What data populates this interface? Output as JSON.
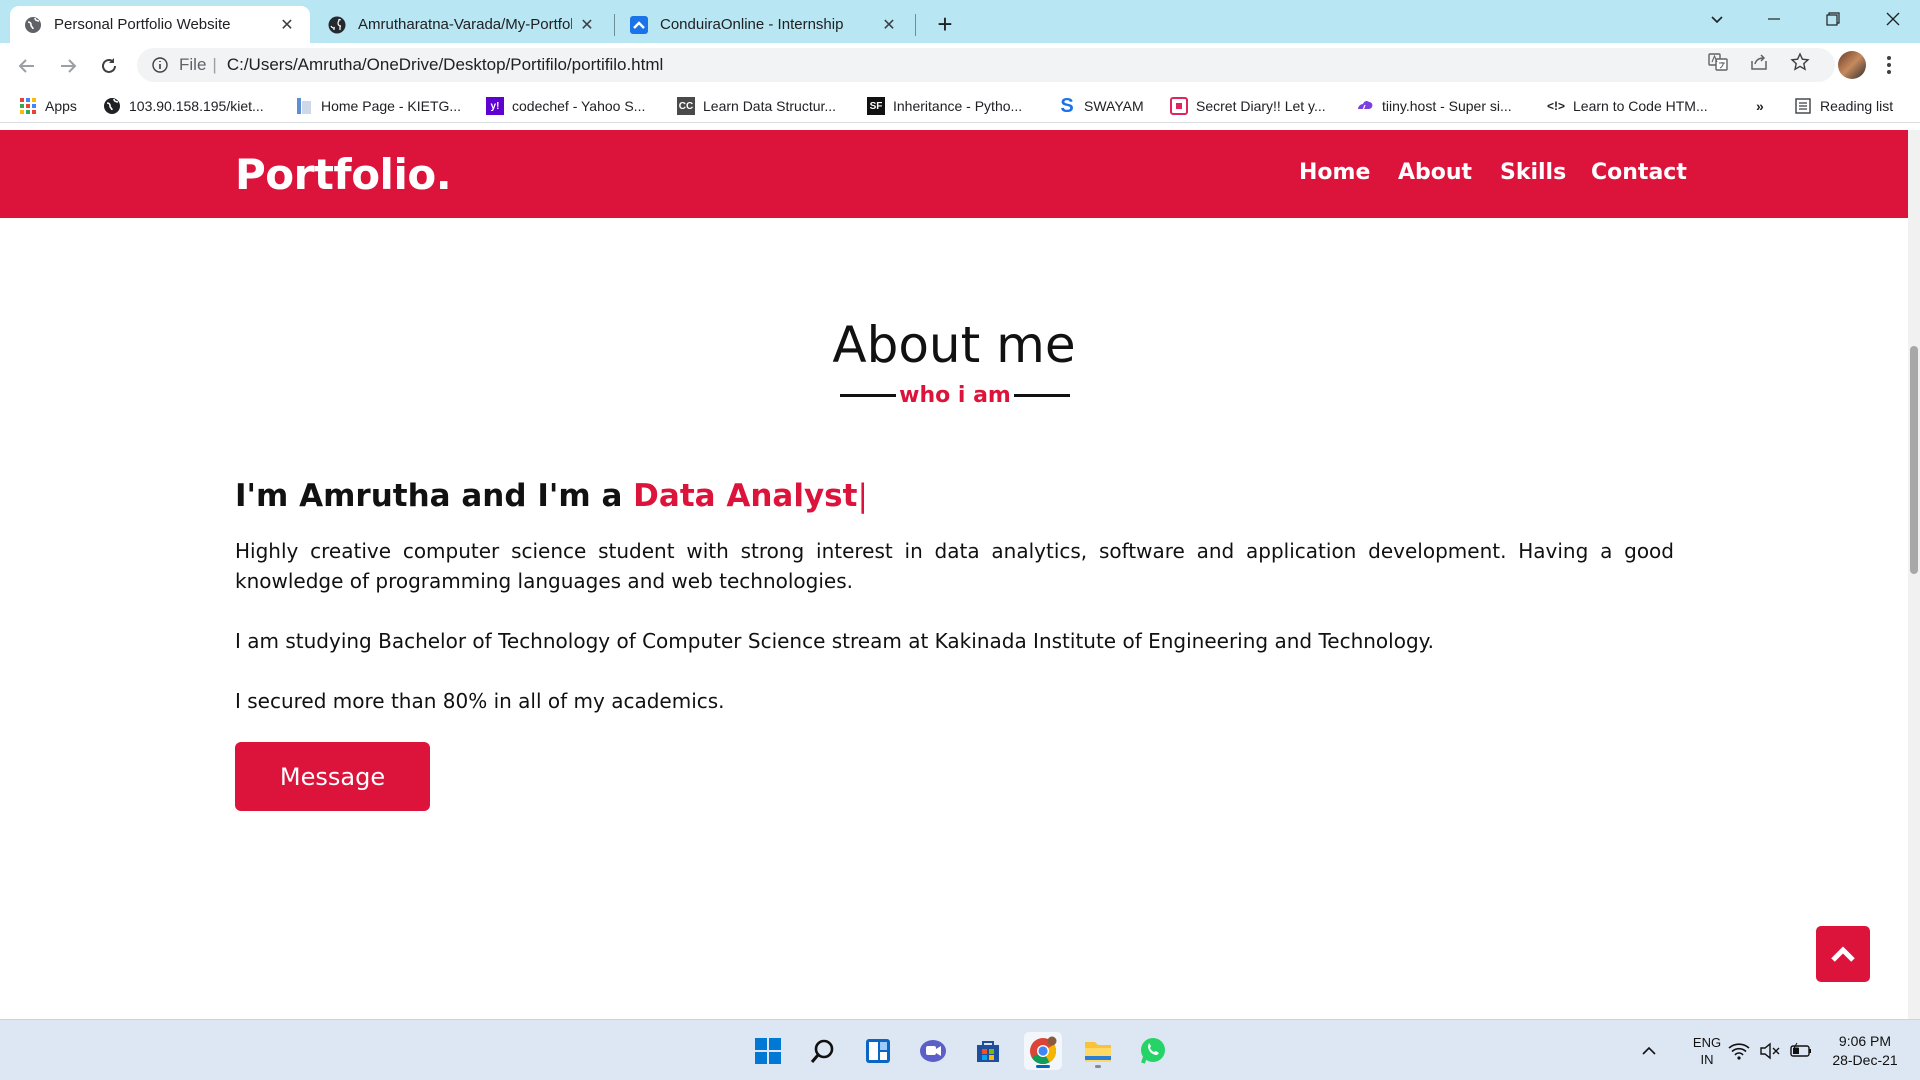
{
  "browser": {
    "tabs": [
      {
        "title": "Personal Portfolio Website",
        "active": true,
        "icon": "globe-icon"
      },
      {
        "title": "Amrutharatna-Varada/My-Portfol",
        "active": false,
        "icon": "github-icon"
      },
      {
        "title": "ConduiraOnline - Internship",
        "active": false,
        "icon": "conduira-icon"
      }
    ],
    "address": {
      "scheme": "File",
      "url": "C:/Users/Amrutha/OneDrive/Desktop/Portifilo/portifilo.html"
    },
    "bookmarks": [
      {
        "label": "Apps",
        "icon": "apps-grid-icon"
      },
      {
        "label": "103.90.158.195/kiet...",
        "icon": "globe-icon"
      },
      {
        "label": "Home Page - KIETG...",
        "icon": "page-icon"
      },
      {
        "label": "codechef - Yahoo S...",
        "icon": "yahoo-icon"
      },
      {
        "label": "Learn Data Structur...",
        "icon": "cc-icon"
      },
      {
        "label": "Inheritance - Pytho...",
        "icon": "sf-icon"
      },
      {
        "label": "SWAYAM",
        "icon": "swayam-icon"
      },
      {
        "label": "Secret Diary!! Let y...",
        "icon": "diary-icon"
      },
      {
        "label": "tiiny.host - Super si...",
        "icon": "tiiny-icon"
      },
      {
        "label": "Learn to Code HTM...",
        "icon": "code-icon"
      }
    ],
    "bookmarks_more": "»",
    "reading_list": "Reading list"
  },
  "site": {
    "logo": "Portfolio.",
    "nav": [
      "Home",
      "About",
      "Skills",
      "Contact"
    ],
    "about": {
      "title": "About me",
      "subtitle": "who i am",
      "intro_prefix": "I'm Amrutha and I'm a ",
      "intro_role": "Data Analyst",
      "intro_cursor": "|",
      "paragraphs": [
        "Highly creative computer science student with strong interest in data analytics, software and application development. Having a good knowledge of programming languages and web technologies.",
        "I am studying Bachelor of Technology of Computer Science stream at Kakinada Institute of Engineering and Technology.",
        "I secured more than 80% in all of my academics."
      ],
      "button": "Message"
    },
    "accent_color": "#dc143c"
  },
  "taskbar": {
    "apps": [
      "windows-start-icon",
      "search-icon",
      "widgets-icon",
      "teams-chat-icon",
      "store-icon",
      "chrome-icon",
      "file-explorer-icon",
      "whatsapp-icon"
    ],
    "lang_top": "ENG",
    "lang_bottom": "IN",
    "time": "9:06 PM",
    "date": "28-Dec-21"
  }
}
